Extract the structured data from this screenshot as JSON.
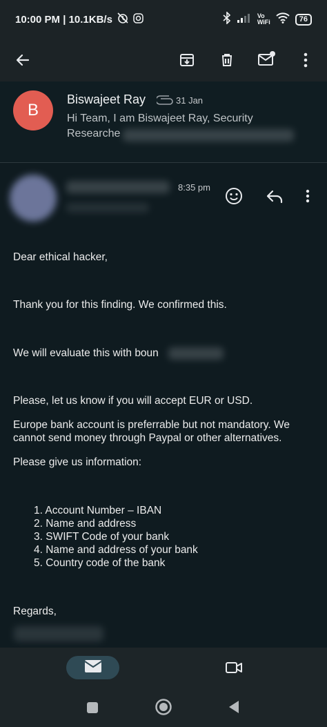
{
  "status_bar": {
    "time_speed": "10:00 PM | 10.1KB/s",
    "vo_wifi_top": "Vo",
    "vo_wifi_bottom": "WiFi",
    "battery": "76"
  },
  "thread": {
    "avatar_letter": "B",
    "sender": "Biswajeet Ray",
    "date": "31 Jan",
    "snippet_line1": "Hi Team, I am Biswajeet Ray, Security",
    "snippet_line2": "Researche"
  },
  "message": {
    "time": "8:35 pm",
    "greeting": "Dear ethical hacker,",
    "para1": "Thank you for this finding. We confirmed this.",
    "para2": "We will evaluate this with boun",
    "para3": "Please, let us know if you will accept EUR or USD.",
    "para4_line1": "Europe bank account is preferrable but not mandatory. We",
    "para4_line2": "cannot send money through Paypal or other alternatives.",
    "para5": "Please give us information:",
    "list": [
      "1. Account Number – IBAN",
      "2. Name and address",
      "3. SWIFT Code of your bank",
      "4. Name and address of your bank",
      "5. Country code of the bank"
    ],
    "closing": "Regards,"
  },
  "colors": {
    "background": "#0f1b20",
    "avatar": "#e25d52",
    "nav_pill": "#2f4a55"
  }
}
